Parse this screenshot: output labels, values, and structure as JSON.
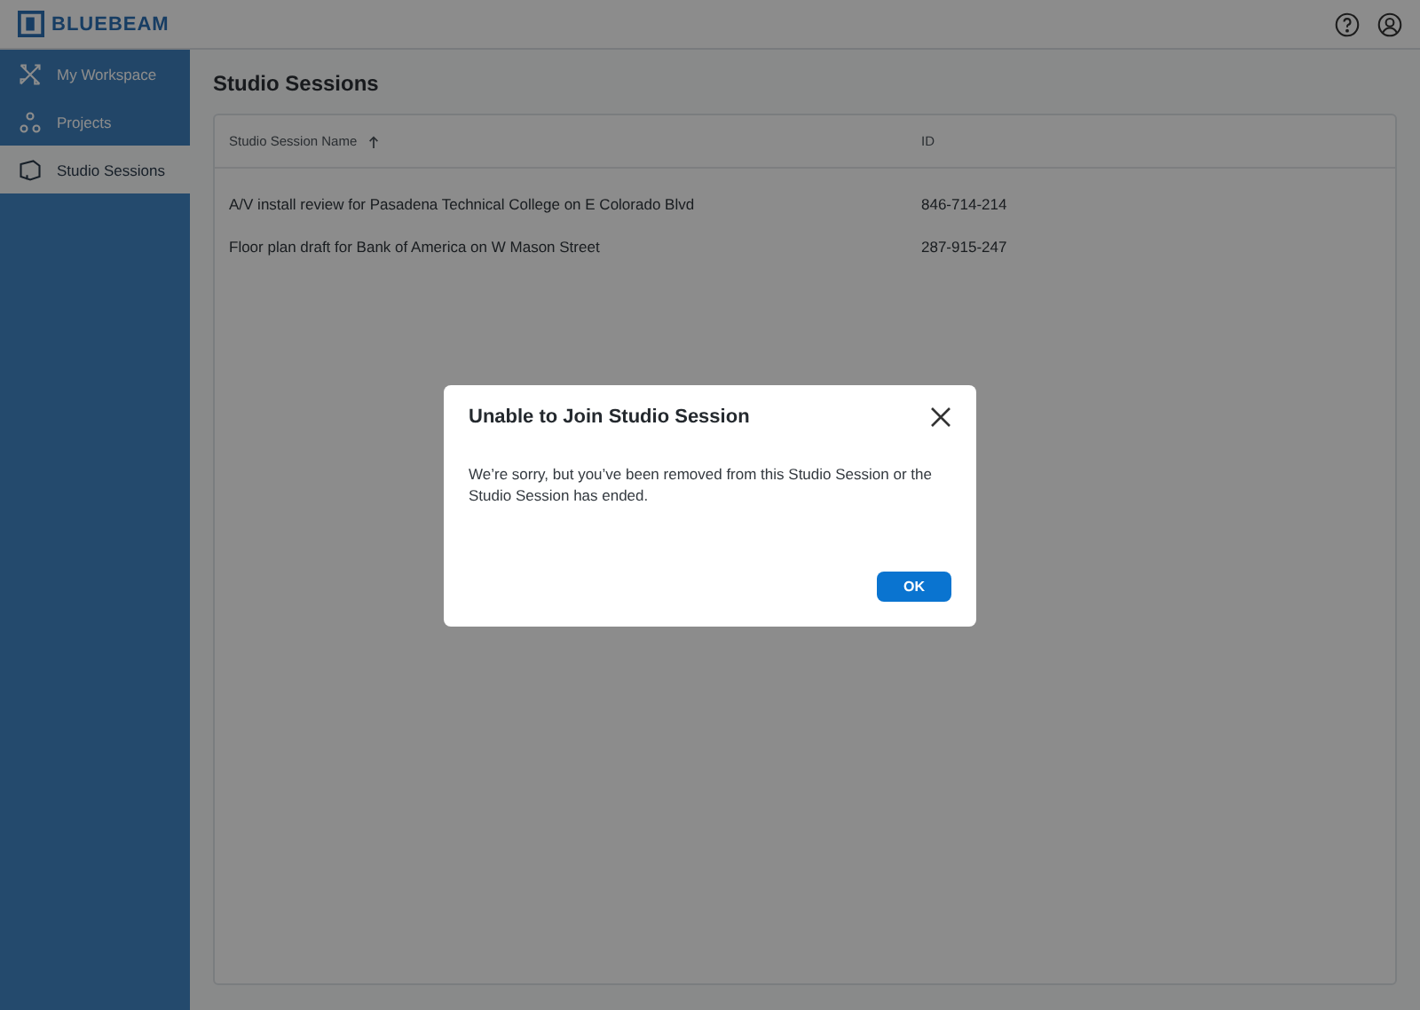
{
  "header": {
    "logo": "BLUEBEAM"
  },
  "sidebar": {
    "items": [
      {
        "label": "My Workspace",
        "selected": false
      },
      {
        "label": "Projects",
        "selected": false
      },
      {
        "label": "Studio Sessions",
        "selected": true
      }
    ]
  },
  "page": {
    "title": "Studio Sessions"
  },
  "table": {
    "columns": [
      {
        "label": "Studio Session Name",
        "sorted_ascending": true
      },
      {
        "label": "ID"
      }
    ],
    "rows": [
      [
        "A/V install review for Pasadena Technical College on E Colorado Blvd",
        "846-714-214"
      ],
      [
        "Floor plan draft for Bank of America on W Mason Street",
        "287-915-247"
      ]
    ]
  },
  "dialog": {
    "title": "Unable to Join Studio Session",
    "message": "We’re sorry, but you’ve been removed from this Studio Session or the Studio Session has ended.",
    "buttons": [
      "OK"
    ]
  }
}
